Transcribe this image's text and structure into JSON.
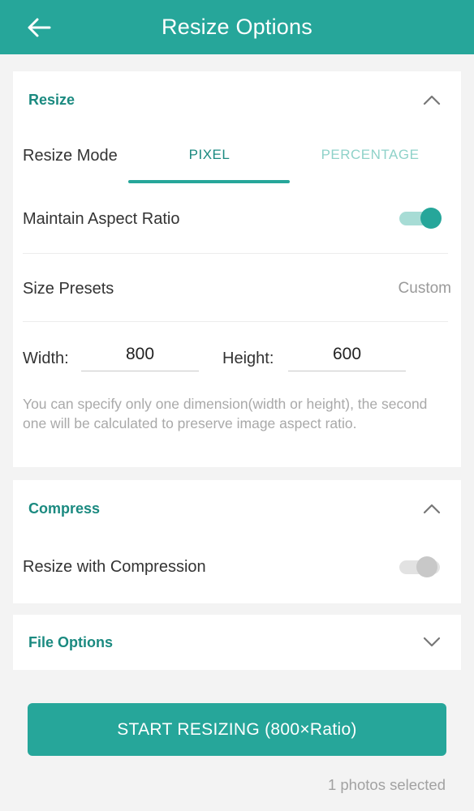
{
  "header": {
    "title": "Resize Options",
    "back_icon": "arrow-left-icon"
  },
  "resize": {
    "title": "Resize",
    "mode_label": "Resize Mode",
    "tabs": [
      {
        "label": "PIXEL",
        "active": true
      },
      {
        "label": "PERCENTAGE",
        "active": false
      }
    ],
    "aspect_label": "Maintain Aspect Ratio",
    "aspect_on": true,
    "presets_label": "Size Presets",
    "presets_value": "Custom",
    "width_label": "Width:",
    "width_value": "800",
    "height_label": "Height:",
    "height_value": "600",
    "hint": "You can specify only one dimension(width or height), the second one will be calculated to preserve image aspect ratio."
  },
  "compress": {
    "title": "Compress",
    "toggle_label": "Resize with Compression",
    "toggle_on": false
  },
  "file_options": {
    "title": "File Options"
  },
  "action": {
    "start_label": "START RESIZING (800×Ratio)"
  },
  "footer": {
    "selected_text": "1 photos selected"
  },
  "colors": {
    "accent": "#26a69a",
    "accent_text": "#1b8a80",
    "accent_light": "#a7dcd5"
  }
}
